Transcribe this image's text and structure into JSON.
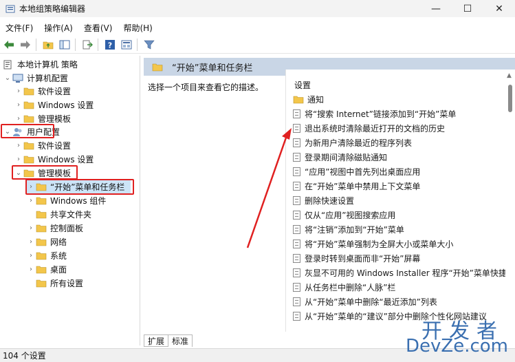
{
  "window": {
    "title": "本地组策略编辑器",
    "minimize": "—",
    "maximize": "☐",
    "close": "✕"
  },
  "menu": [
    "文件(F)",
    "操作(A)",
    "查看(V)",
    "帮助(H)"
  ],
  "tree": {
    "root": "本地计算机 策略",
    "computer_config": "计算机配置",
    "computer_children": [
      "软件设置",
      "Windows 设置",
      "管理模板"
    ],
    "user_config": "用户配置",
    "user_children": [
      "软件设置",
      "Windows 设置",
      "管理模板"
    ],
    "admin_children": [
      "“开始”菜单和任务栏",
      "Windows 组件",
      "共享文件夹",
      "控制面板",
      "网络",
      "系统",
      "桌面",
      "所有设置"
    ]
  },
  "right_header": {
    "title": "“开始”菜单和任务栏"
  },
  "description": "选择一个项目来查看它的描述。",
  "list": {
    "header": "设置",
    "folder_item": "通知",
    "policies": [
      "将“搜索 Internet”链接添加到“开始”菜单",
      "退出系统时清除最近打开的文档的历史",
      "为新用户清除最近的程序列表",
      "登录期间清除磁贴通知",
      "“应用”视图中首先列出桌面应用",
      "在“开始”菜单中禁用上下文菜单",
      "删除快速设置",
      "仅从“应用”视图搜索应用",
      "将“注销”添加到“开始”菜单",
      "将“开始”菜单强制为全屏大小或菜单大小",
      "登录时转到桌面而非“开始”屏幕",
      "灰显不可用的 Windows Installer 程序“开始”菜单快捷",
      "从任务栏中删除“人脉”栏",
      "从“开始”菜单中删除“最近添加”列表",
      "从“开始”菜单的“建议”部分中删除个性化网站建议"
    ]
  },
  "tabs": [
    "扩展",
    "标准"
  ],
  "status": "104 个设置",
  "watermark": {
    "top": "开发者",
    "bottom": "DevZe.com"
  },
  "colors": {
    "highlight_red": "#e02020",
    "header_blue": "#c9d6e6",
    "selection": "#cce4f7",
    "folder_yellow": "#f3c64b"
  }
}
